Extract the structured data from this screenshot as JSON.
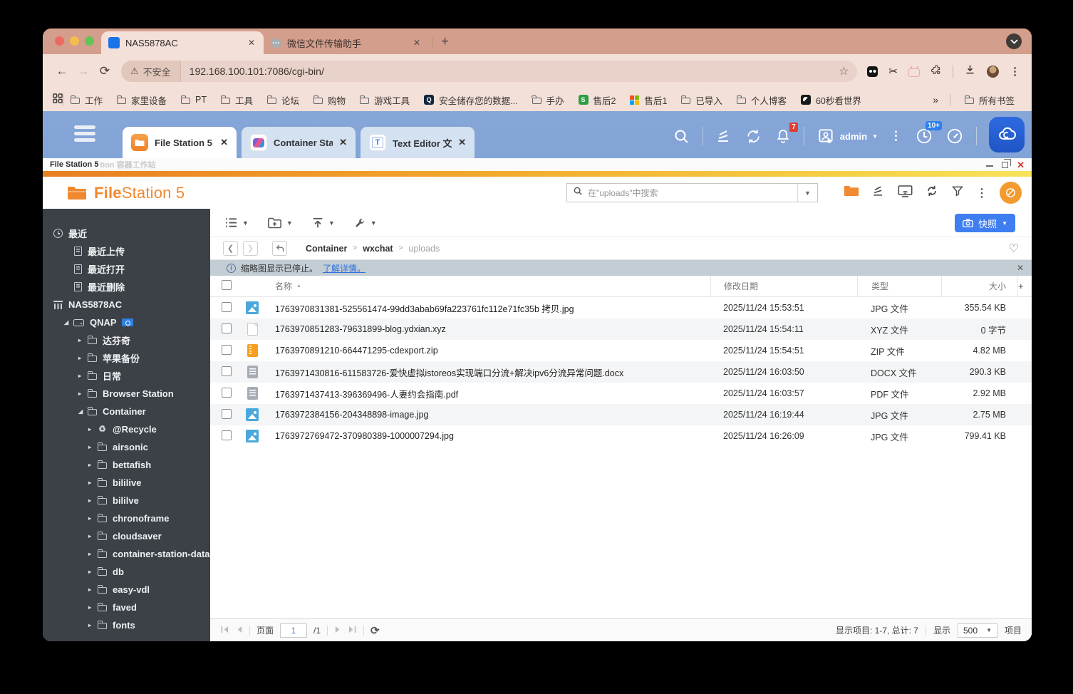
{
  "browser": {
    "tabs": [
      {
        "title": "NAS5878AC",
        "active": true
      },
      {
        "title": "微信文件传输助手",
        "active": false
      }
    ],
    "new_tab_label": "+",
    "address": {
      "security": "不安全",
      "url": "192.168.100.101:7086/cgi-bin/"
    },
    "bookmarks": [
      {
        "label": "工作",
        "icon": "folder"
      },
      {
        "label": "家里设备",
        "icon": "folder"
      },
      {
        "label": "PT",
        "icon": "folder"
      },
      {
        "label": "工具",
        "icon": "folder"
      },
      {
        "label": "论坛",
        "icon": "folder"
      },
      {
        "label": "购物",
        "icon": "folder"
      },
      {
        "label": "游戏工具",
        "icon": "folder"
      },
      {
        "label": "安全储存您的数据...",
        "icon": "qnap"
      },
      {
        "label": "手办",
        "icon": "folder"
      },
      {
        "label": "售后2",
        "icon": "shop-green"
      },
      {
        "label": "售后1",
        "icon": "ms-grid"
      },
      {
        "label": "已导入",
        "icon": "folder"
      },
      {
        "label": "个人博客",
        "icon": "folder"
      },
      {
        "label": "60秒看世界",
        "icon": "site-dark"
      }
    ],
    "bookmarks_overflow": "»",
    "all_bookmarks": "所有书签"
  },
  "qnap_desktop": {
    "tabs": [
      {
        "label": "File Station 5",
        "icon": "filestation",
        "active": true
      },
      {
        "label": "Container Sta...",
        "icon": "container-station",
        "active": false
      },
      {
        "label": "Text Editor 文...",
        "icon": "text-editor",
        "active": false
      }
    ],
    "notification_badge": "7",
    "user": "admin",
    "info_badge": "10+"
  },
  "window": {
    "title": "File Station 5",
    "ghost_title": "tion 容器工作站"
  },
  "filestation": {
    "logo_primary": "File",
    "logo_secondary": "Station 5",
    "search_placeholder": "在\"uploads\"中搜索",
    "snapshot_label": "快照",
    "breadcrumb": [
      {
        "label": "Container",
        "current": false
      },
      {
        "label": "wxchat",
        "current": false
      },
      {
        "label": "uploads",
        "current": true
      }
    ],
    "notice_text": "缩略图显示已停止。",
    "notice_link": "了解详情。",
    "columns": {
      "name": "名称",
      "date": "修改日期",
      "type": "类型",
      "size": "大小",
      "add": "+"
    },
    "files": [
      {
        "icon": "image",
        "name": "1763970831381-525561474-99dd3abab69fa223761fc112e71fc35b 拷贝.jpg",
        "date": "2025/11/24 15:53:51",
        "type": "JPG 文件",
        "size": "355.54 KB"
      },
      {
        "icon": "plain",
        "name": "1763970851283-79631899-blog.ydxian.xyz",
        "date": "2025/11/24 15:54:11",
        "type": "XYZ 文件",
        "size": "0 字节"
      },
      {
        "icon": "zip",
        "name": "1763970891210-664471295-cdexport.zip",
        "date": "2025/11/24 15:54:51",
        "type": "ZIP 文件",
        "size": "4.82 MB"
      },
      {
        "icon": "doc",
        "name": "1763971430816-611583726-爱快虚拟istoreos实现端口分流+解决ipv6分流异常问题.docx",
        "date": "2025/11/24 16:03:50",
        "type": "DOCX 文件",
        "size": "290.3 KB"
      },
      {
        "icon": "doc",
        "name": "1763971437413-396369496-人妻约会指南.pdf",
        "date": "2025/11/24 16:03:57",
        "type": "PDF 文件",
        "size": "2.92 MB"
      },
      {
        "icon": "image",
        "name": "1763972384156-204348898-image.jpg",
        "date": "2025/11/24 16:19:44",
        "type": "JPG 文件",
        "size": "2.75 MB"
      },
      {
        "icon": "image",
        "name": "1763972769472-370980389-1000007294.jpg",
        "date": "2025/11/24 16:26:09",
        "type": "JPG 文件",
        "size": "799.41 KB"
      }
    ],
    "pager": {
      "page_label": "页面",
      "page_value": "1",
      "page_total": "/1",
      "summary": "显示项目: 1-7, 总计: 7",
      "show_label": "显示",
      "page_size": "500",
      "unit_label": "项目"
    }
  },
  "sidebar": {
    "items": [
      {
        "label": "最近",
        "level": "l0",
        "icon": "clock",
        "arrow": "",
        "bold": true
      },
      {
        "label": "最近上传",
        "level": "l1",
        "icon": "doc",
        "arrow": ""
      },
      {
        "label": "最近打开",
        "level": "l1",
        "icon": "doc",
        "arrow": ""
      },
      {
        "label": "最近删除",
        "level": "l1",
        "icon": "doc",
        "arrow": ""
      },
      {
        "label": "NAS5878AC",
        "level": "l0",
        "icon": "nas",
        "arrow": "",
        "bold": true
      },
      {
        "label": "QNAP",
        "level": "l1a",
        "icon": "drive",
        "arrow": "open",
        "bold": true,
        "badge": true
      },
      {
        "label": "达芬奇",
        "level": "l2",
        "icon": "folder",
        "arrow": "closed"
      },
      {
        "label": "苹果备份",
        "level": "l2",
        "icon": "folder",
        "arrow": "closed"
      },
      {
        "label": "日常",
        "level": "l2",
        "icon": "folder",
        "arrow": "closed"
      },
      {
        "label": "Browser Station",
        "level": "l2",
        "icon": "folder",
        "arrow": "closed"
      },
      {
        "label": "Container",
        "level": "l2",
        "icon": "folder",
        "arrow": "open"
      },
      {
        "label": "@Recycle",
        "level": "l3",
        "icon": "recycle",
        "arrow": "closed"
      },
      {
        "label": "airsonic",
        "level": "l3",
        "icon": "folder",
        "arrow": "closed"
      },
      {
        "label": "bettafish",
        "level": "l3",
        "icon": "folder",
        "arrow": "closed"
      },
      {
        "label": "bililive",
        "level": "l3",
        "icon": "folder",
        "arrow": "closed"
      },
      {
        "label": "bililve",
        "level": "l3",
        "icon": "folder",
        "arrow": "closed"
      },
      {
        "label": "chronoframe",
        "level": "l3",
        "icon": "folder",
        "arrow": "closed"
      },
      {
        "label": "cloudsaver",
        "level": "l3",
        "icon": "folder",
        "arrow": "closed"
      },
      {
        "label": "container-station-data",
        "level": "l3",
        "icon": "folder",
        "arrow": "closed"
      },
      {
        "label": "db",
        "level": "l3",
        "icon": "folder",
        "arrow": "closed"
      },
      {
        "label": "easy-vdl",
        "level": "l3",
        "icon": "folder",
        "arrow": "closed"
      },
      {
        "label": "faved",
        "level": "l3",
        "icon": "folder",
        "arrow": "closed"
      },
      {
        "label": "fonts",
        "level": "l3",
        "icon": "folder",
        "arrow": "closed"
      }
    ]
  },
  "colors": {
    "accent_orange": "#f0882e",
    "accent_blue": "#3f7ef0",
    "qnap_bar_blue": "#6089c2",
    "sidebar_bg": "#3c4147",
    "browser_chrome": "#d49e8c"
  }
}
